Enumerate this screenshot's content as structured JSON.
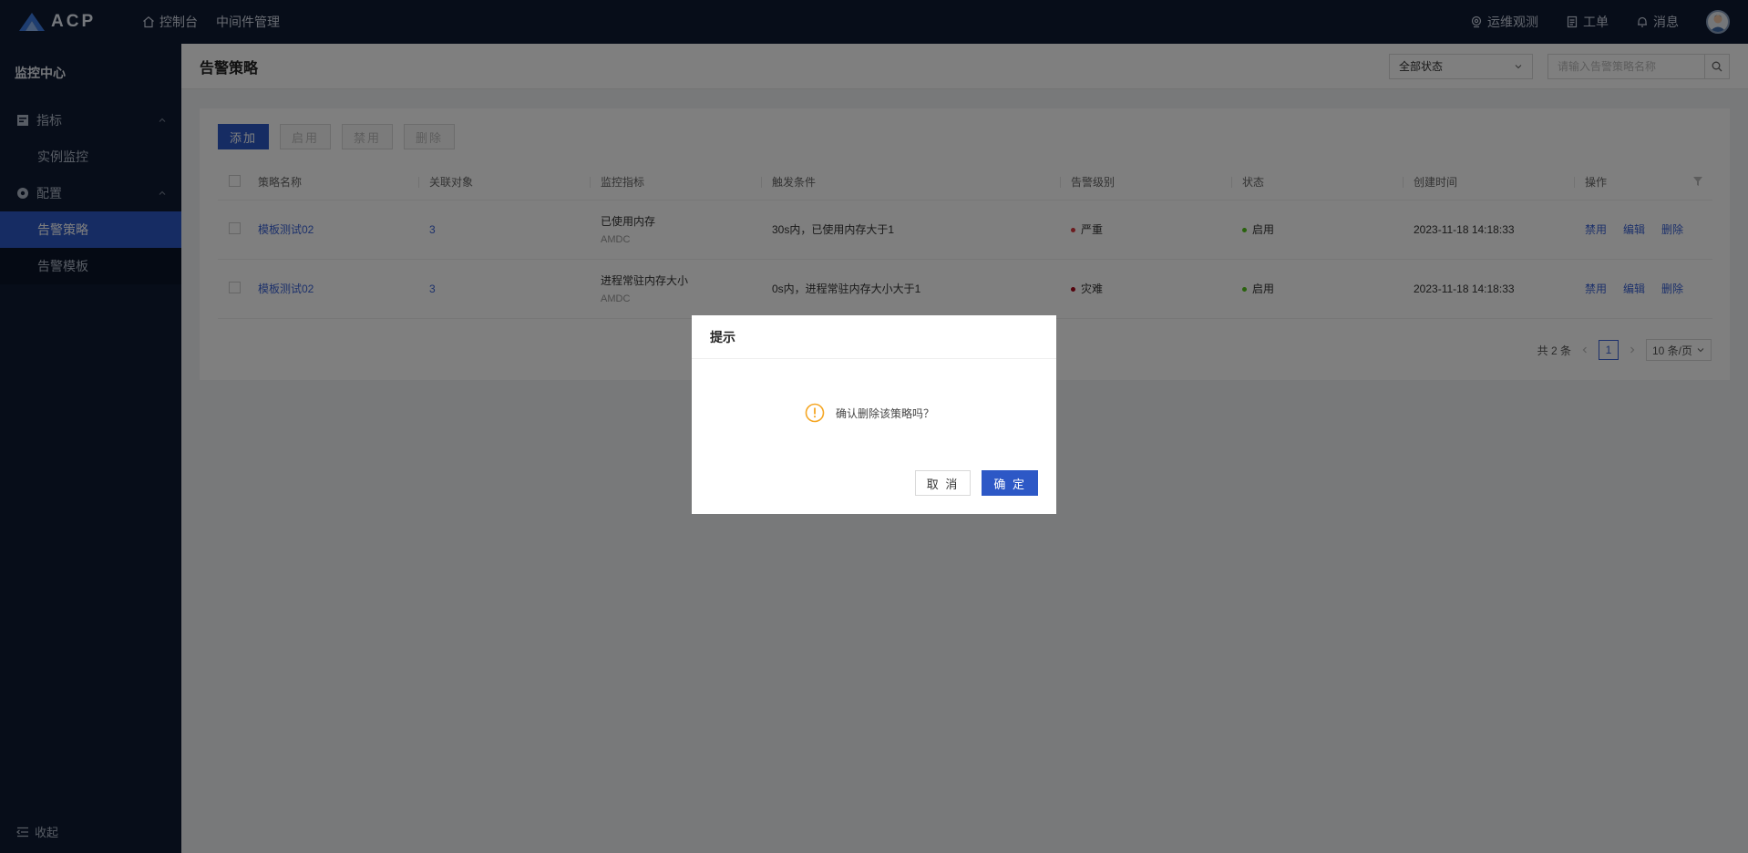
{
  "app": {
    "logo_text": "ACP"
  },
  "topnav": [
    {
      "label": "控制台",
      "icon": "home-icon"
    },
    {
      "label": "中间件管理"
    }
  ],
  "topright": {
    "observe": "运维观测",
    "ticket": "工单",
    "message": "消息"
  },
  "sidebar": {
    "title": "监控中心",
    "groups": [
      {
        "label": "指标",
        "icon": "metrics-icon",
        "items": [
          "实例监控"
        ]
      },
      {
        "label": "配置",
        "icon": "settings-icon",
        "items": [
          "告警策略",
          "告警模板"
        ]
      }
    ],
    "active_item": "告警策略",
    "collapse_label": "收起"
  },
  "page": {
    "title": "告警策略",
    "status_select": "全部状态",
    "search_placeholder": "请输入告警策略名称"
  },
  "toolbar": {
    "add": "添加",
    "enable": "启用",
    "disable": "禁用",
    "delete": "删除"
  },
  "table": {
    "columns": [
      "策略名称",
      "关联对象",
      "监控指标",
      "触发条件",
      "告警级别",
      "状态",
      "创建时间",
      "操作"
    ],
    "rows": [
      {
        "name": "模板测试02",
        "objects": "3",
        "metric": "已使用内存",
        "metric_sub": "AMDC",
        "condition": "30s内，已使用内存大于1",
        "level": "严重",
        "level_color": "#d9363e",
        "status": "启用",
        "status_color": "#52c41a",
        "created": "2023-11-18 14:18:33",
        "ops": [
          "禁用",
          "编辑",
          "删除"
        ]
      },
      {
        "name": "模板测试02",
        "objects": "3",
        "metric": "进程常驻内存大小",
        "metric_sub": "AMDC",
        "condition": "0s内，进程常驻内存大小大于1",
        "level": "灾难",
        "level_color": "#a8071a",
        "status": "启用",
        "status_color": "#52c41a",
        "created": "2023-11-18 14:18:33",
        "ops": [
          "禁用",
          "编辑",
          "删除"
        ]
      }
    ]
  },
  "pager": {
    "total": "共 2 条",
    "current": "1",
    "page_size": "10 条/页"
  },
  "modal": {
    "title": "提示",
    "message": "确认删除该策略吗？",
    "cancel": "取 消",
    "confirm": "确 定",
    "icon": "warning-icon",
    "icon_color": "#f5a623"
  },
  "colors": {
    "topbar_bg": "#0f1b33",
    "accent": "#2d58c6",
    "link": "#3a63d6"
  }
}
